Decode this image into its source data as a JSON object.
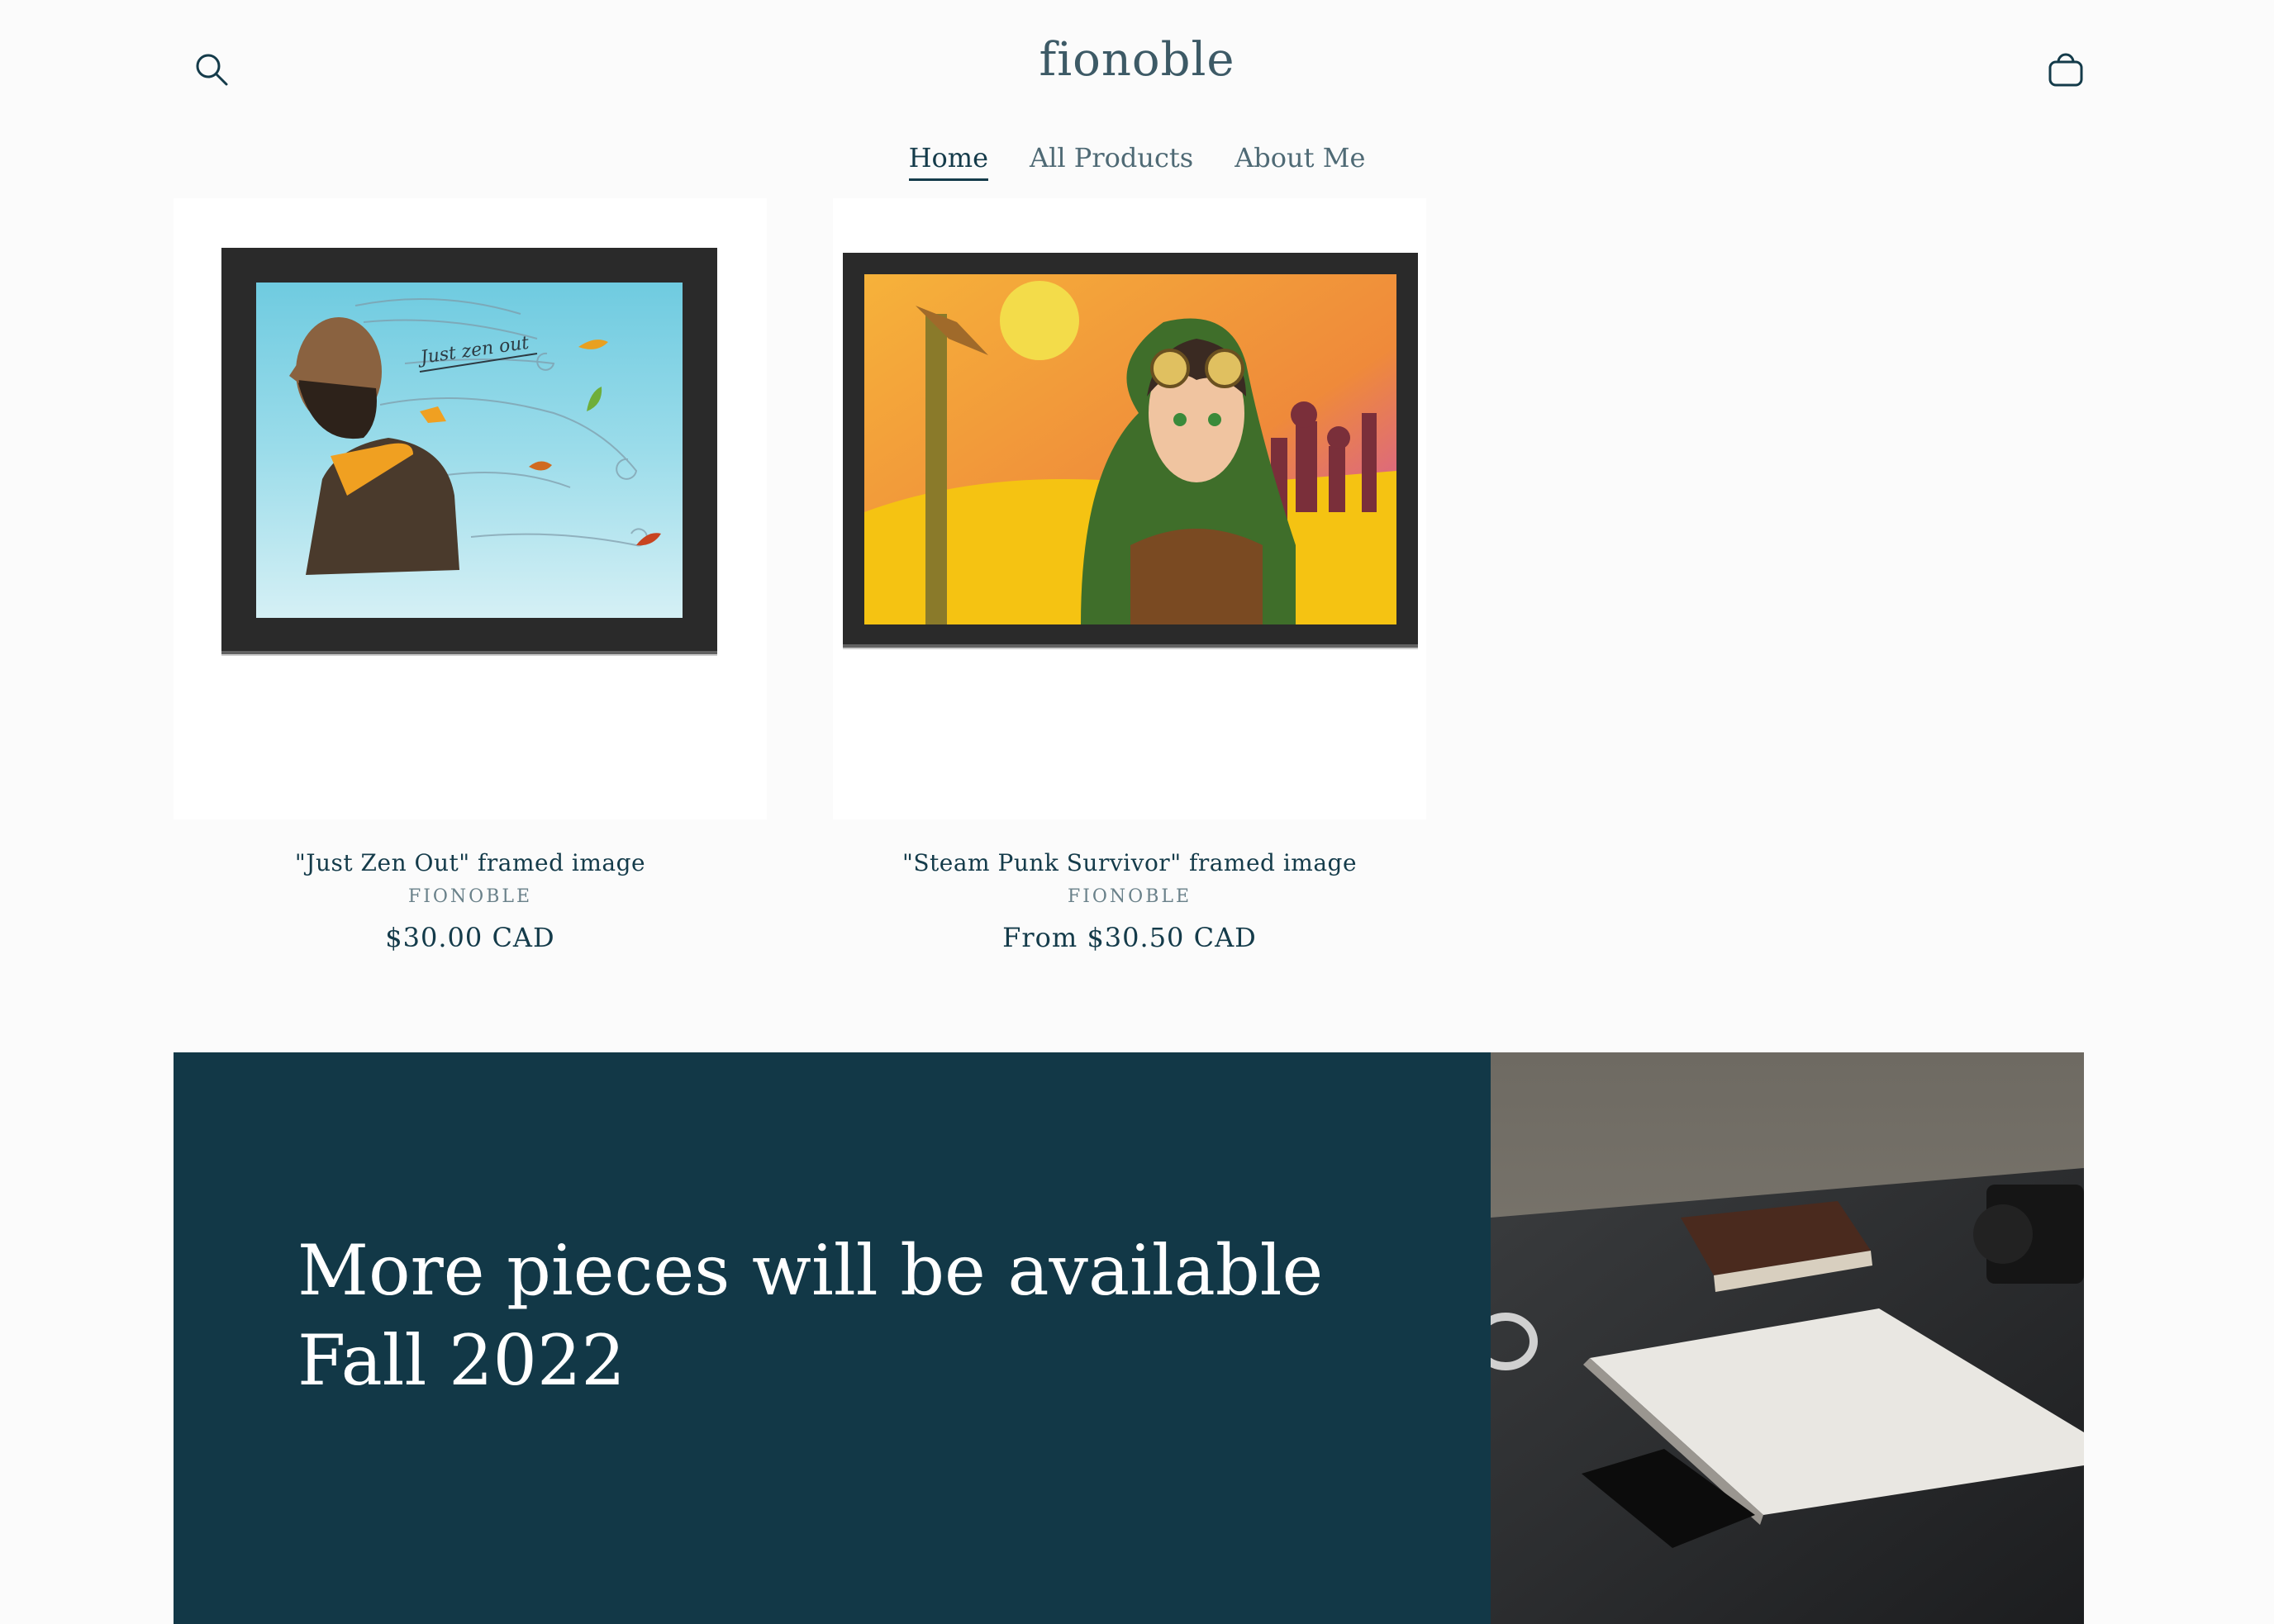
{
  "header": {
    "logo": "fionoble",
    "search_icon": "search-icon",
    "cart_icon": "cart-icon",
    "nav": [
      {
        "label": "Home",
        "active": true
      },
      {
        "label": "All Products",
        "active": false
      },
      {
        "label": "About Me",
        "active": false
      }
    ]
  },
  "products": [
    {
      "title": "\"Just Zen Out\" framed image",
      "vendor": "FIONOBLE",
      "price": "$30.00 CAD",
      "art_caption": "Just zen out"
    },
    {
      "title": "\"Steam Punk Survivor\" framed image",
      "vendor": "FIONOBLE",
      "price": "From $30.50 CAD"
    }
  ],
  "banner": {
    "heading": "More pieces will be available Fall 2022",
    "background_color": "#123847"
  },
  "colors": {
    "accent": "#143b4a",
    "page_background": "#fbfbfb"
  }
}
